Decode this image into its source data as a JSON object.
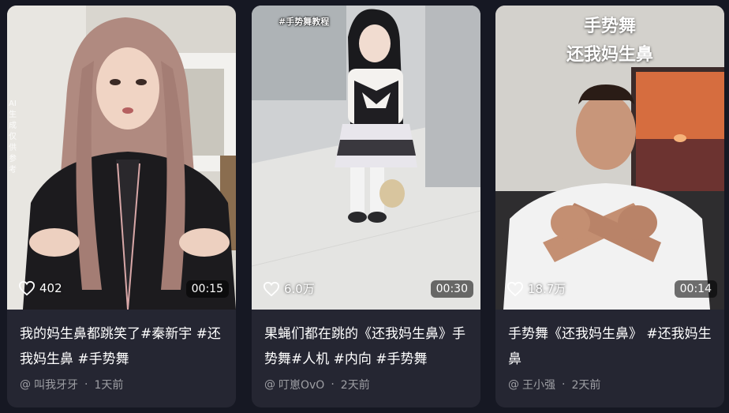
{
  "cards": [
    {
      "ai_note": "AI生成 仅供参考",
      "likes": "402",
      "duration": "00:15",
      "title": "我的妈生鼻都跳笑了#秦新宇 #还我妈生鼻 #手势舞",
      "author_prefix": "@",
      "author": "叫我牙牙",
      "dot": "·",
      "time": "1天前"
    },
    {
      "overlay_tag": "#手势舞教程",
      "likes": "6.0万",
      "duration": "00:30",
      "title": "果蝇们都在跳的《还我妈生鼻》手势舞#人机 #内向 #手势舞",
      "author_prefix": "@",
      "author": "叮崽OvO",
      "dot": "·",
      "time": "2天前"
    },
    {
      "caption_line1": "手势舞",
      "caption_line2": "还我妈生鼻",
      "likes": "18.7万",
      "duration": "00:14",
      "title": "手势舞《还我妈生鼻》 #还我妈生鼻",
      "author_prefix": "@",
      "author": "王小强",
      "dot": "·",
      "time": "2天前"
    }
  ],
  "colors": {
    "page_bg": "#161823",
    "card_bg": "#252632"
  },
  "icons": [
    "heart-outline-icon"
  ]
}
